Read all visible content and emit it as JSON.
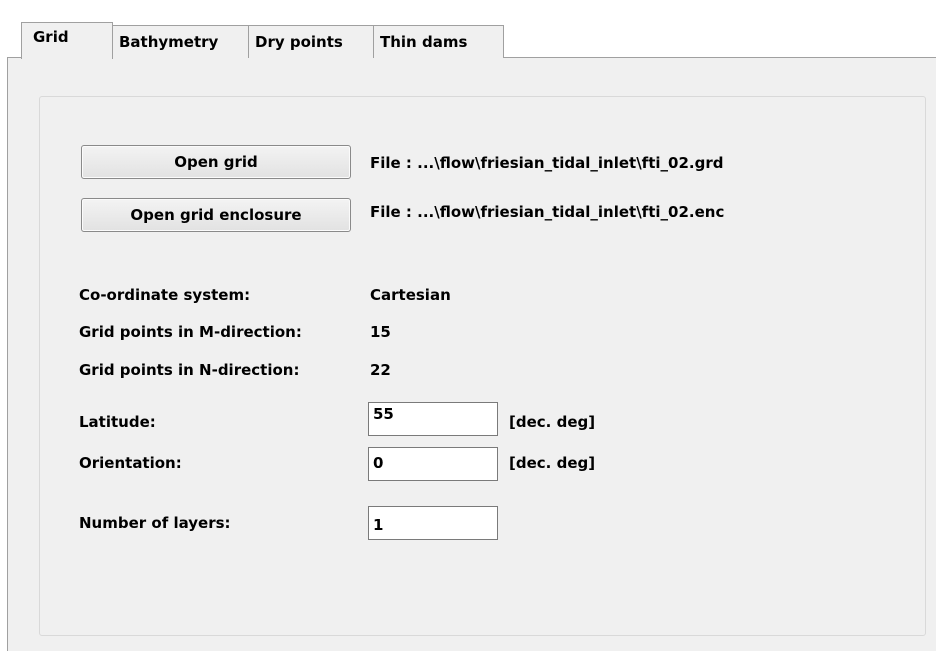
{
  "tabs": [
    {
      "label": "Grid",
      "active": true
    },
    {
      "label": "Bathymetry",
      "active": false
    },
    {
      "label": "Dry points",
      "active": false
    },
    {
      "label": "Thin dams",
      "active": false
    }
  ],
  "buttons": {
    "open_grid": "Open grid",
    "open_grid_enclosure": "Open grid enclosure"
  },
  "files": {
    "grid_file": "File :  ...\\flow\\friesian_tidal_inlet\\fti_02.grd",
    "enclosure_file": "File :  ...\\flow\\friesian_tidal_inlet\\fti_02.enc"
  },
  "info": {
    "coord_label": "Co-ordinate system:",
    "coord_value": "Cartesian",
    "m_label": "Grid points in M-direction:",
    "m_value": "15",
    "n_label": "Grid points in N-direction:",
    "n_value": "22"
  },
  "fields": {
    "latitude_label": "Latitude:",
    "latitude_value": "55",
    "latitude_unit": "[dec. deg]",
    "orientation_label": "Orientation:",
    "orientation_value": "0",
    "orientation_unit": "[dec. deg]",
    "layers_label": "Number of layers:",
    "layers_value": "1"
  }
}
